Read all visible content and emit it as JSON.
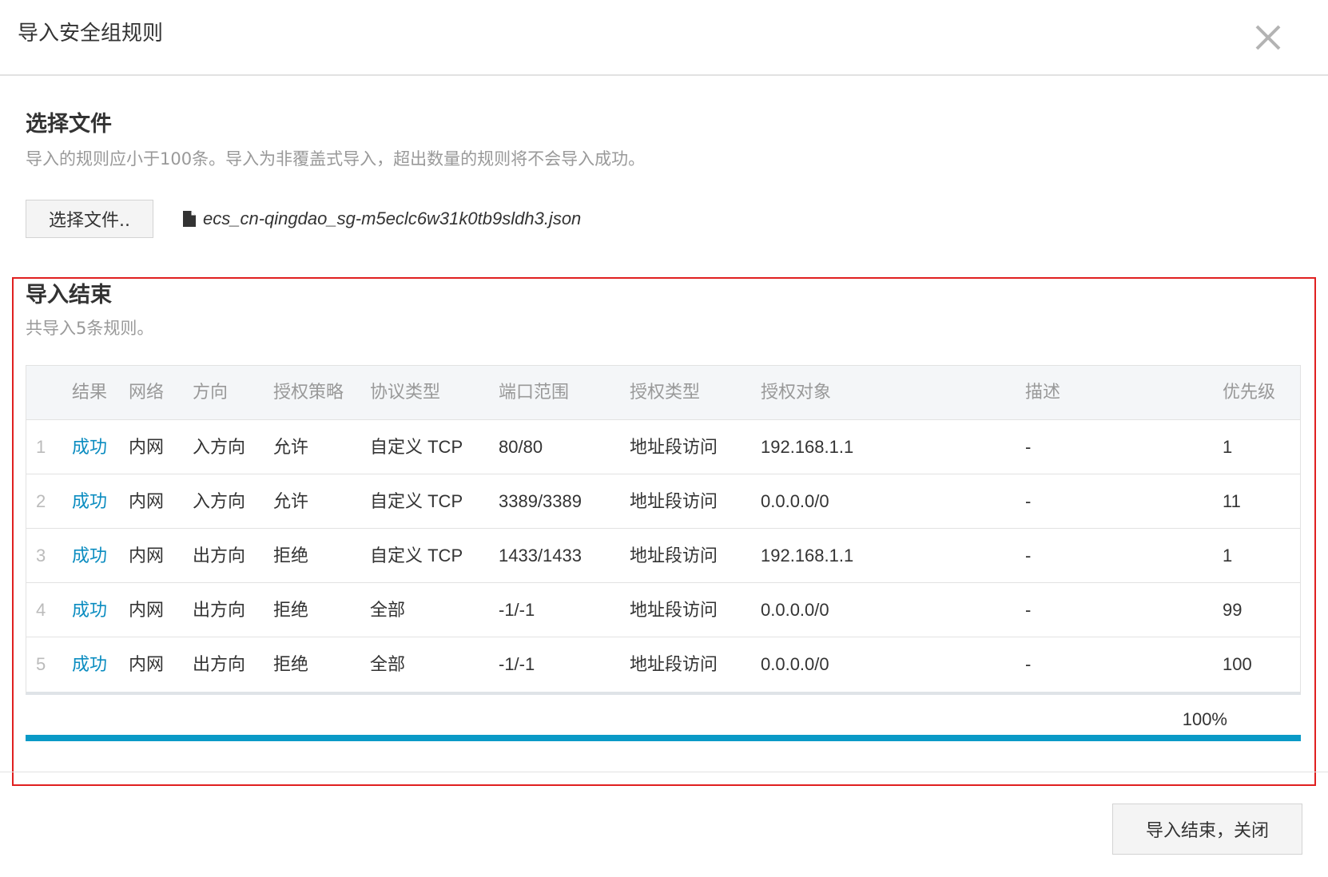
{
  "dialog": {
    "title": "导入安全组规则"
  },
  "select_file": {
    "title": "选择文件",
    "hint": "导入的规则应小于100条。导入为非覆盖式导入，超出数量的规则将不会导入成功。",
    "button_label": "选择文件..",
    "file_name": "ecs_cn-qingdao_sg-m5eclc6w31k0tb9sldh3.json"
  },
  "result": {
    "title": "导入结束",
    "summary": "共导入5条规则。",
    "columns": [
      "结果",
      "网络",
      "方向",
      "授权策略",
      "协议类型",
      "端口范围",
      "授权类型",
      "授权对象",
      "描述",
      "优先级"
    ],
    "rows": [
      {
        "index": "1",
        "result": "成功",
        "network": "内网",
        "direction": "入方向",
        "policy": "允许",
        "protocol": "自定义 TCP",
        "port": "80/80",
        "auth_type": "地址段访问",
        "target": "192.168.1.1",
        "desc": "-",
        "priority": "1"
      },
      {
        "index": "2",
        "result": "成功",
        "network": "内网",
        "direction": "入方向",
        "policy": "允许",
        "protocol": "自定义 TCP",
        "port": "3389/3389",
        "auth_type": "地址段访问",
        "target": "0.0.0.0/0",
        "desc": "-",
        "priority": "11"
      },
      {
        "index": "3",
        "result": "成功",
        "network": "内网",
        "direction": "出方向",
        "policy": "拒绝",
        "protocol": "自定义 TCP",
        "port": "1433/1433",
        "auth_type": "地址段访问",
        "target": "192.168.1.1",
        "desc": "-",
        "priority": "1"
      },
      {
        "index": "4",
        "result": "成功",
        "network": "内网",
        "direction": "出方向",
        "policy": "拒绝",
        "protocol": "全部",
        "port": "-1/-1",
        "auth_type": "地址段访问",
        "target": "0.0.0.0/0",
        "desc": "-",
        "priority": "99"
      },
      {
        "index": "5",
        "result": "成功",
        "network": "内网",
        "direction": "出方向",
        "policy": "拒绝",
        "protocol": "全部",
        "port": "-1/-1",
        "auth_type": "地址段访问",
        "target": "0.0.0.0/0",
        "desc": "-",
        "priority": "100"
      }
    ],
    "progress_label": "100%",
    "progress_value": 100
  },
  "footer": {
    "finish_button_label": "导入结束，关闭"
  },
  "icons": {
    "close": "close-icon",
    "file": "file-icon"
  },
  "colors": {
    "accent": "#0a9ac7",
    "success_text": "#0a8cc0",
    "highlight_border": "#e02020"
  }
}
